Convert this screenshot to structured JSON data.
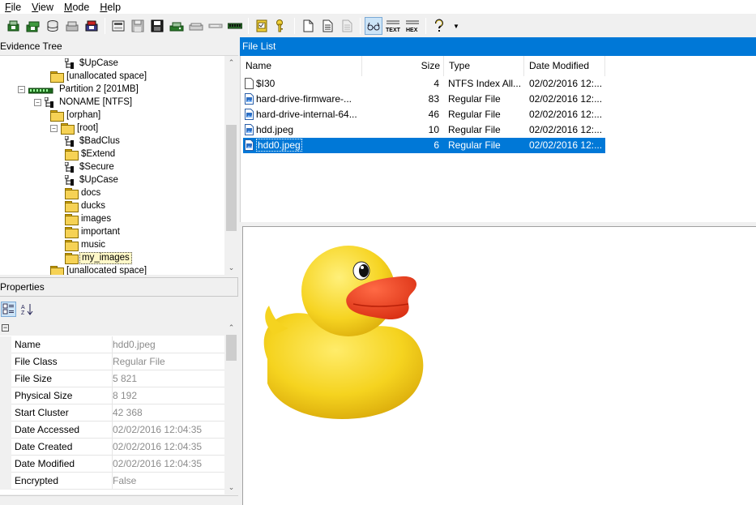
{
  "menu": {
    "items": [
      {
        "label": "File"
      },
      {
        "label": "View"
      },
      {
        "label": "Mode"
      },
      {
        "label": "Help"
      }
    ]
  },
  "toolbar": {
    "buttons": [
      {
        "name": "add-evidence-icon"
      },
      {
        "name": "add-all-evidence-icon"
      },
      {
        "name": "add-image-icon"
      },
      {
        "name": "remove-evidence-icon"
      },
      {
        "name": "remove-all-icon"
      },
      {
        "name": "create-image-icon"
      },
      {
        "name": "save-icon"
      },
      {
        "name": "export-icon"
      },
      {
        "name": "mount-image-icon"
      },
      {
        "name": "drive-icon"
      },
      {
        "name": "decrypt-icon"
      },
      {
        "name": "memory-icon"
      },
      {
        "name": "verify-icon"
      },
      {
        "name": "key-icon"
      },
      {
        "name": "page-icon"
      },
      {
        "name": "document-icon"
      },
      {
        "name": "report-icon"
      },
      {
        "name": "auto-view-icon"
      },
      {
        "name": "text-view-icon"
      },
      {
        "name": "hex-view-icon"
      },
      {
        "name": "help-icon"
      }
    ],
    "text_label": "TEXT",
    "hex_label": "HEX"
  },
  "evidence_tree": {
    "title": "Evidence Tree",
    "nodes": [
      {
        "label": "$UpCase",
        "kind": "system"
      },
      {
        "label": "[unallocated space]",
        "kind": "folder"
      },
      {
        "label": "Partition 2 [201MB]",
        "kind": "partition"
      },
      {
        "label": "NONAME [NTFS]",
        "kind": "system"
      },
      {
        "label": "[orphan]",
        "kind": "folder"
      },
      {
        "label": "[root]",
        "kind": "folder"
      },
      {
        "label": "$BadClus",
        "kind": "system"
      },
      {
        "label": "$Extend",
        "kind": "folder"
      },
      {
        "label": "$Secure",
        "kind": "system"
      },
      {
        "label": "$UpCase",
        "kind": "system"
      },
      {
        "label": "docs",
        "kind": "folder"
      },
      {
        "label": "ducks",
        "kind": "folder"
      },
      {
        "label": "images",
        "kind": "folder"
      },
      {
        "label": "important",
        "kind": "folder"
      },
      {
        "label": "music",
        "kind": "folder"
      },
      {
        "label": "my_images",
        "kind": "folder",
        "selected": true
      },
      {
        "label": "[unallocated space]",
        "kind": "folder"
      }
    ]
  },
  "properties": {
    "title": "Properties",
    "rows": [
      {
        "key": "Name",
        "value": "hdd0.jpeg"
      },
      {
        "key": "File Class",
        "value": "Regular File"
      },
      {
        "key": "File Size",
        "value": "5 821"
      },
      {
        "key": "Physical Size",
        "value": "8 192"
      },
      {
        "key": "Start Cluster",
        "value": "42 368"
      },
      {
        "key": "Date Accessed",
        "value": "02/02/2016 12:04:35"
      },
      {
        "key": "Date Created",
        "value": "02/02/2016 12:04:35"
      },
      {
        "key": "Date Modified",
        "value": "02/02/2016 12:04:35"
      },
      {
        "key": "Encrypted",
        "value": "False"
      }
    ]
  },
  "file_list": {
    "title": "File List",
    "columns": {
      "name": "Name",
      "size": "Size",
      "type": "Type",
      "date": "Date Modified"
    },
    "rows": [
      {
        "name": "$I30",
        "size": "4",
        "type": "NTFS Index All...",
        "date": "02/02/2016 12:...",
        "icon": "file-icon"
      },
      {
        "name": "hard-drive-firmware-...",
        "size": "83",
        "type": "Regular File",
        "date": "02/02/2016 12:...",
        "icon": "image-file-icon"
      },
      {
        "name": "hard-drive-internal-64...",
        "size": "46",
        "type": "Regular File",
        "date": "02/02/2016 12:...",
        "icon": "image-file-icon"
      },
      {
        "name": "hdd.jpeg",
        "size": "10",
        "type": "Regular File",
        "date": "02/02/2016 12:...",
        "icon": "image-file-icon"
      },
      {
        "name": "hdd0.jpeg",
        "size": "6",
        "type": "Regular File",
        "date": "02/02/2016 12:...",
        "icon": "image-file-icon",
        "selected": true
      }
    ]
  },
  "viewer": {
    "image": "rubber-duck"
  },
  "colors": {
    "accent": "#0078d7",
    "duck_body": "#f5d31f",
    "duck_beak": "#e83a1b"
  }
}
